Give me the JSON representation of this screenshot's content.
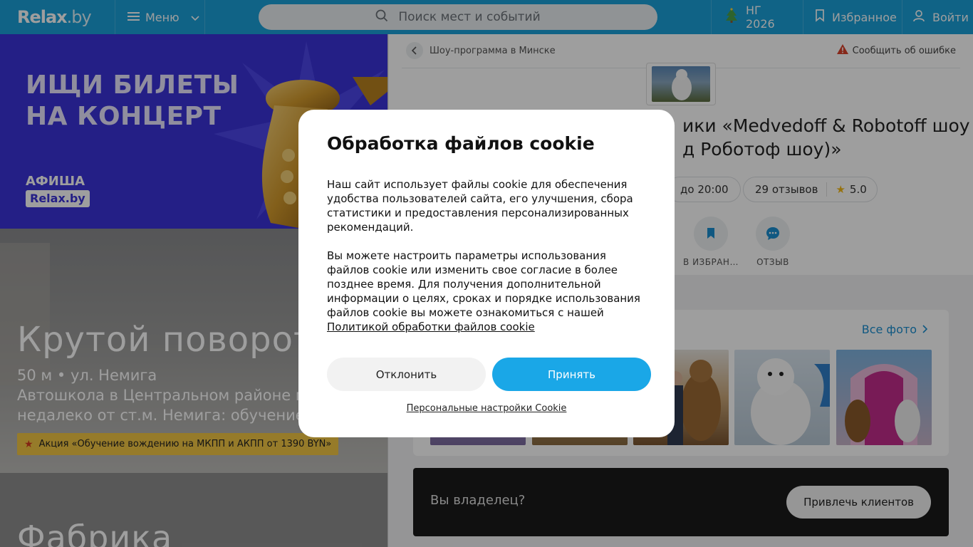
{
  "header": {
    "logo": "Relax",
    "logo_suffix": ".by",
    "menu_label": "Меню",
    "search_placeholder": "Поиск мест и событий",
    "ng_label": "НГ 2026",
    "favorites_label": "Избранное",
    "login_label": "Войти",
    "brand_color": "#1aa0d8"
  },
  "left": {
    "banner": {
      "line1": "ИЩИ БИЛЕТЫ",
      "line2": "НА КОНЦЕРТ",
      "afisha": "АФИША",
      "afisha_badge": "Relax.by"
    },
    "promo1": {
      "title": "Крутой поворот",
      "meta": "50 м • ул. Немига",
      "desc1": "Автошкола в Центральном районе м",
      "desc2": "недалеко от ст.м. Немига: обучение",
      "action": "Акция «Обучение вождению на МКПП и АКПП от 1390 BYN»"
    },
    "promo2": {
      "title": "Фабрика"
    }
  },
  "page": {
    "breadcrumb": "Шоу-программа в Минске",
    "report": "Сообщить об ошибке",
    "title_line1": "ики «Medvedoff & Robotoff шоу",
    "title_line2": "д Роботоф шоу)»",
    "hours": "до 20:00",
    "reviews": "29 отзывов",
    "rating": "5.0",
    "action_fav": "В ИЗБРАН…",
    "action_review": "ОТЗЫВ",
    "all_photos": "Все фото",
    "owner_question": "Вы владелец?",
    "owner_button": "Привлечь клиентов"
  },
  "cookie": {
    "title": "Обработка файлов cookie",
    "para1": "Наш сайт использует файлы cookie для обеспечения удобства пользователей сайта, его улучшения, сбора статистики и предоставления персонализированных рекомендаций.",
    "para2": "Вы можете настроить параметры использования файлов cookie или изменить свое согласие в более позднее время. Для получения дополнительной информации о целях, сроках и порядке использования файлов cookie вы можете ознакомиться с нашей",
    "policy_link": "Политикой обработки файлов cookie",
    "decline": "Отклонить",
    "accept": "Принять",
    "personal": "Персональные настройки Cookie"
  }
}
